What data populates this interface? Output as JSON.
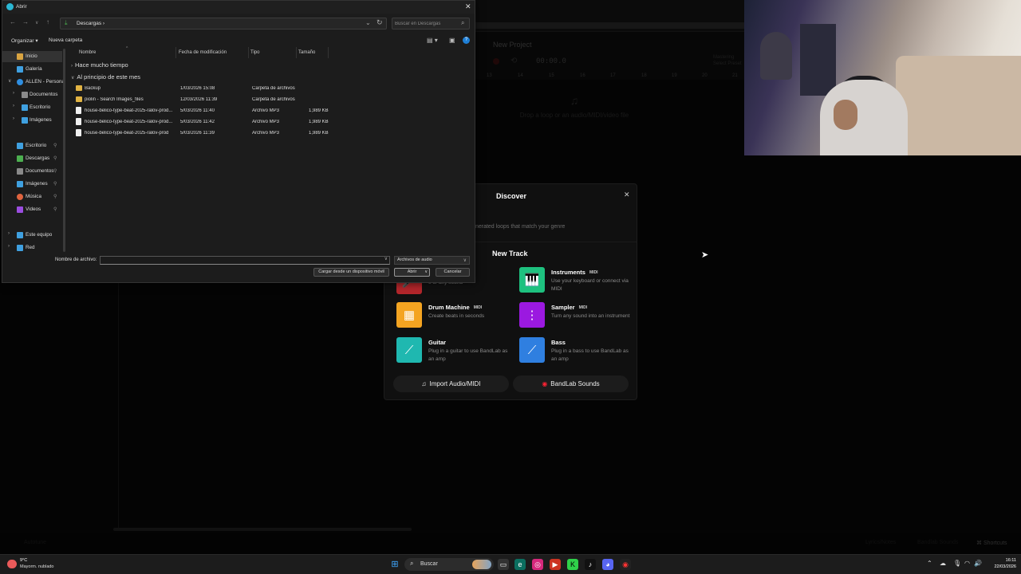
{
  "bandlab": {
    "project_name": "New Project",
    "timecode": "00:00.0",
    "mastering": [
      "Mastering",
      "Select Preset"
    ],
    "ruler": [
      "13",
      "14",
      "15",
      "16",
      "17",
      "18",
      "19",
      "20",
      "21"
    ],
    "drop_text": "Drop a loop or an audio/MIDI/video file",
    "shortcuts": "Shortcuts",
    "bottom_items": [
      "Autotune",
      "Lyrics/Notes",
      "Bandlab Sounds"
    ]
  },
  "discover": {
    "title": "Discover",
    "subtitle": "to-generated loops that match your genre",
    "new_track_title": "New Track",
    "tracks": [
      {
        "name": "",
        "badge": "",
        "desc": "e or any sound",
        "color": "#b3262b",
        "icon": "mic-icon",
        "glyph": "🎤"
      },
      {
        "name": "Instruments",
        "badge": "MIDI",
        "desc": "Use your keyboard or connect via MIDI",
        "color": "#1ec17f",
        "icon": "keyboard-icon",
        "glyph": "🎹"
      },
      {
        "name": "Drum Machine",
        "badge": "MIDI",
        "desc": "Create beats in seconds",
        "color": "#f4a421",
        "icon": "drum-machine-icon",
        "glyph": "▦"
      },
      {
        "name": "Sampler",
        "badge": "MIDI",
        "desc": "Turn any sound into an instrument",
        "color": "#9b19e0",
        "icon": "waveform-icon",
        "glyph": "⋮"
      },
      {
        "name": "Guitar",
        "badge": "",
        "desc": "Plug in a guitar to use BandLab as an amp",
        "color": "#1fb8b0",
        "icon": "guitar-icon",
        "glyph": "⟋"
      },
      {
        "name": "Bass",
        "badge": "",
        "desc": "Plug in a bass to use BandLab as an amp",
        "color": "#2f7fe0",
        "icon": "bass-icon",
        "glyph": "⟋"
      }
    ],
    "import_label": "Import Audio/MIDI",
    "sounds_label": "BandLab Sounds"
  },
  "dialog": {
    "title": "Abrir",
    "breadcrumb": "Descargas  ›",
    "search_placeholder": "Buscar en Descargas",
    "organize": "Organizar ▾",
    "new_folder": "Nueva carpeta",
    "nav": [
      {
        "label": "Inicio",
        "icon": "home-icon",
        "color": "#d9a441",
        "exp": "",
        "pin": "",
        "selected": true
      },
      {
        "label": "Galería",
        "icon": "gallery-icon",
        "color": "#3fa0e0",
        "exp": "",
        "pin": "",
        "selected": false
      },
      {
        "label": "ALLEN - Personal",
        "icon": "onedrive-icon",
        "color": "#2f8ee0",
        "exp": "∨",
        "pin": "",
        "selected": false
      },
      {
        "label": "Documentos",
        "icon": "documents-icon",
        "color": "#8a8a8a",
        "exp": "›",
        "pin": "",
        "selected": false
      },
      {
        "label": "Escritorio",
        "icon": "desktop-icon",
        "color": "#3fa0e0",
        "exp": "›",
        "pin": "",
        "selected": false
      },
      {
        "label": "Imágenes",
        "icon": "pictures-icon",
        "color": "#3fa0e0",
        "exp": "›",
        "pin": "",
        "selected": false
      },
      {
        "label": "Escritorio",
        "icon": "desktop-icon",
        "color": "#3fa0e0",
        "exp": "",
        "pin": "📌",
        "selected": false
      },
      {
        "label": "Descargas",
        "icon": "downloads-icon",
        "color": "#4caf50",
        "exp": "",
        "pin": "📌",
        "selected": false
      },
      {
        "label": "Documentos",
        "icon": "documents-icon",
        "color": "#8a8a8a",
        "exp": "",
        "pin": "📌",
        "selected": false
      },
      {
        "label": "Imágenes",
        "icon": "pictures-icon",
        "color": "#3fa0e0",
        "exp": "",
        "pin": "📌",
        "selected": false
      },
      {
        "label": "Música",
        "icon": "music-icon",
        "color": "#e0643f",
        "exp": "",
        "pin": "📌",
        "selected": false
      },
      {
        "label": "Videos",
        "icon": "videos-icon",
        "color": "#9b4de0",
        "exp": "",
        "pin": "📌",
        "selected": false
      },
      {
        "label": "Este equipo",
        "icon": "this-pc-icon",
        "color": "#3fa0e0",
        "exp": "›",
        "pin": "",
        "selected": false
      },
      {
        "label": "Red",
        "icon": "network-icon",
        "color": "#3fa0e0",
        "exp": "›",
        "pin": "",
        "selected": false
      }
    ],
    "columns": [
      "Nombre",
      "Fecha de modificación",
      "Tipo",
      "Tamaño"
    ],
    "groups": [
      "Hace mucho tiempo",
      "Al principio de este mes"
    ],
    "files": [
      {
        "name": "Backup",
        "date": "1/03/2026 15:08",
        "type": "Carpeta de archivos",
        "size": "",
        "kind": "folder"
      },
      {
        "name": "piolin - Search Images_files",
        "date": "12/03/2026 11:39",
        "type": "Carpeta de archivos",
        "size": "",
        "kind": "folder"
      },
      {
        "name": "house-belico-type-beat-2025-ralov-prod...",
        "date": "5/03/2026 11:40",
        "type": "Archivo MP3",
        "size": "1,989 KB",
        "kind": "mp3"
      },
      {
        "name": "house-belico-type-beat-2025-ralov-prod...",
        "date": "5/03/2026 11:42",
        "type": "Archivo MP3",
        "size": "1,989 KB",
        "kind": "mp3"
      },
      {
        "name": "house-belico-type-beat-2025-ralov-prod",
        "date": "5/03/2026 11:39",
        "type": "Archivo MP3",
        "size": "1,989 KB",
        "kind": "mp3"
      }
    ],
    "filename_label": "Nombre de archivo:",
    "filename_value": "",
    "filetype": "Archivos de audio",
    "mobile_btn": "Cargar desde un dispositivo móvil",
    "open_btn": "Abrir",
    "cancel_btn": "Cancelar"
  },
  "taskbar": {
    "temp": "9°C",
    "weather": "Mayorm. nublado",
    "search": "Buscar",
    "time": "16:11",
    "date": "22/03/2026"
  }
}
